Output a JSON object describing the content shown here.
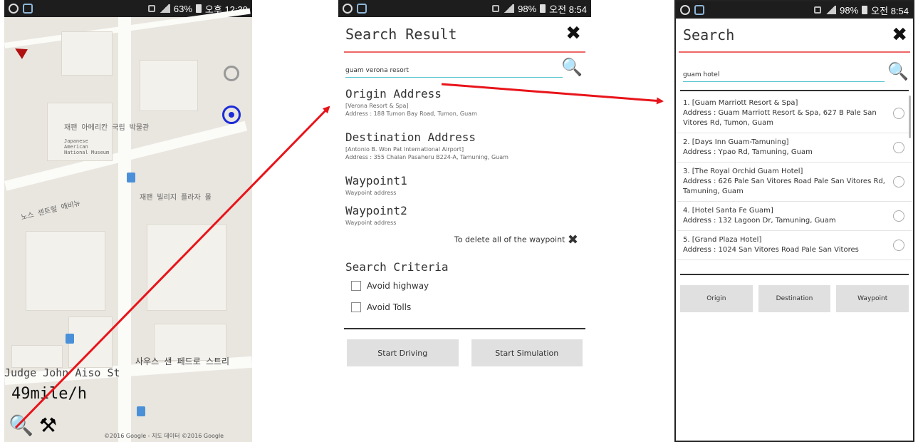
{
  "status_bar": {
    "p1_time": "오후 12:39",
    "p1_battery": "63%",
    "p2_time": "오전 8:54",
    "p2_battery": "98%",
    "p3_time": "오전 8:54",
    "p3_battery": "98%"
  },
  "map": {
    "street1": "Judge John Aiso St",
    "street2": "사우스 샌 페드로 스트리",
    "label1": "재팬 아메리칸 국립 박물관",
    "label2": "재팬 빌리지 플라자 몰",
    "label3": "노스 센트럴 애비뉴",
    "label4": "Japanese American National Museum",
    "speed": "49mile/h",
    "copyright": "©2016 Google - 지도 데이터 ©2016 Google"
  },
  "search_result": {
    "title": "Search Result",
    "query": "guam verona resort",
    "origin_title": "Origin Address",
    "origin_name": "[Verona Resort & Spa]",
    "origin_address": "Address : 188 Tumon Bay Road, Tumon, Guam",
    "dest_title": "Destination Address",
    "dest_name": "[Antonio B. Won Pat International Airport]",
    "dest_address": "Address : 355 Chalan Pasaheru B224-A, Tamuning, Guam",
    "wp1_title": "Waypoint1",
    "wp1_address": "Waypoint address",
    "wp2_title": "Waypoint2",
    "wp2_address": "Waypoint address",
    "delete_label": "To delete all of the waypoint",
    "criteria_title": "Search Criteria",
    "avoid_highway": "Avoid highway",
    "avoid_tolls": "Avoid Tolls",
    "start_driving": "Start Driving",
    "start_simulation": "Start Simulation"
  },
  "search": {
    "title": "Search",
    "query": "guam hotel",
    "results": [
      {
        "name": "1. [Guam Marriott Resort & Spa]",
        "address": "Address : Guam Marriott Resort & Spa, 627 B Pale San Vitores Rd, Tumon, Guam"
      },
      {
        "name": "2. [Days Inn Guam-Tamuning]",
        "address": "Address : Ypao Rd, Tamuning, Guam"
      },
      {
        "name": "3. [The Royal Orchid Guam Hotel]",
        "address": "Address : 626 Pale San Vitores Road Pale San Vitores Rd, Tamuning, Guam"
      },
      {
        "name": "4. [Hotel Santa Fe Guam]",
        "address": "Address : 132 Lagoon Dr, Tamuning, Guam"
      },
      {
        "name": "5. [Grand Plaza Hotel]",
        "address": "Address : 1024 San Vitores Road Pale San Vitores"
      }
    ],
    "btn_origin": "Origin",
    "btn_destination": "Destination",
    "btn_waypoint": "Waypoint"
  },
  "colors": {
    "arrow": "#e8141a",
    "accent_line": "#e66666",
    "input_underline": "#58c5d0",
    "locate_blue": "#1c2bd8"
  }
}
